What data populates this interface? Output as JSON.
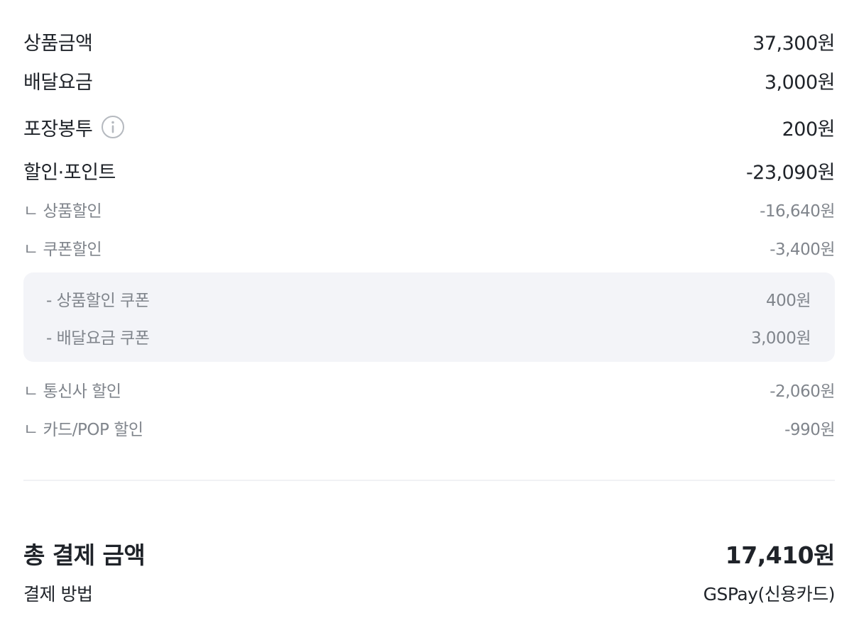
{
  "summary": {
    "product_amount": {
      "label": "상품금액",
      "value": "37,300원"
    },
    "delivery_fee": {
      "label": "배달요금",
      "value": "3,000원"
    },
    "packaging_bag": {
      "label": "포장봉투",
      "value": "200원",
      "icon": "info-icon"
    },
    "discount_points": {
      "label": "할인·포인트",
      "value": "-23,090원"
    }
  },
  "discounts": {
    "product_discount": {
      "label": "ㄴ 상품할인",
      "value": "-16,640원"
    },
    "coupon_discount": {
      "label": "ㄴ 쿠폰할인",
      "value": "-3,400원"
    },
    "coupons": [
      {
        "label": "- 상품할인 쿠폰",
        "value": "400원"
      },
      {
        "label": "- 배달요금 쿠폰",
        "value": "3,000원"
      }
    ],
    "carrier_discount": {
      "label": "ㄴ 통신사 할인",
      "value": "-2,060원"
    },
    "card_pop_discount": {
      "label": "ㄴ 카드/POP 할인",
      "value": "-990원"
    }
  },
  "total": {
    "label": "총 결제 금액",
    "value": "17,410원"
  },
  "payment_method": {
    "label": "결제 방법",
    "value": "GSPay(신용카드)"
  },
  "colors": {
    "primary_text": "#1f2329",
    "secondary_text": "#80858c",
    "coupon_box_bg": "#f3f4f8",
    "divider": "#f1f2f4"
  }
}
